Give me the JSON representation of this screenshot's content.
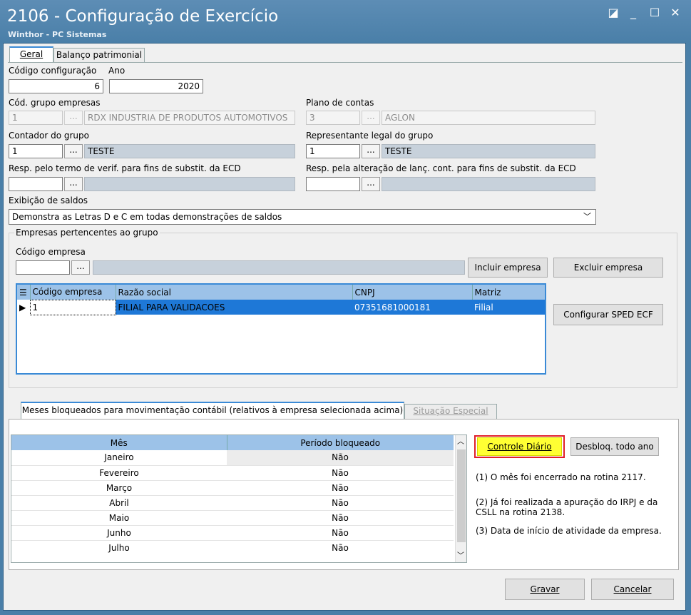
{
  "window": {
    "title": "2106 - Configuração de Exercício",
    "subtitle": "Winthor - PC Sistemas",
    "controls": [
      "◪",
      "_",
      "☐",
      "✕"
    ]
  },
  "tabs": [
    {
      "label": "Geral"
    },
    {
      "label": "Balanço patrimonial"
    }
  ],
  "fields": {
    "codigo_config_label": "Código configuração",
    "codigo_config_value": "6",
    "ano_label": "Ano",
    "ano_value": "2020",
    "grupo_empresas_label": "Cód. grupo empresas",
    "grupo_empresas_code": "1",
    "grupo_empresas_name": "RDX INDUSTRIA DE PRODUTOS AUTOMOTIVOS",
    "plano_contas_label": "Plano de contas",
    "plano_contas_code": "3",
    "plano_contas_name": "AGLON",
    "contador_label": "Contador do grupo",
    "contador_code": "1",
    "contador_name": "TESTE",
    "representante_label": "Representante legal do grupo",
    "representante_code": "1",
    "representante_name": "TESTE",
    "resp_termo_label": "Resp. pelo termo de verif. para fins de substit. da ECD",
    "resp_alteracao_label": "Resp. pela alteração de lanç. cont. para fins de substit. da ECD",
    "exibicao_label": "Exibição de saldos",
    "exibicao_value": "Demonstra as Letras D e C em todas demonstrações de saldos",
    "dots": "..."
  },
  "empresas_group": {
    "title": "Empresas pertencentes ao grupo",
    "codigo_label": "Código empresa",
    "incluir_button": "Incluir empresa",
    "excluir_button": "Excluir empresa",
    "sped_button": "Configurar SPED ECF",
    "columns": [
      "Código empresa",
      "Razão social",
      "CNPJ",
      "Matriz"
    ],
    "rows": [
      {
        "codigo": "1",
        "razao": "FILIAL PARA VALIDACOES",
        "cnpj": "07351681000181",
        "matriz": "Filial"
      }
    ]
  },
  "bottom_tabs": [
    {
      "label": "Meses bloqueados para movimentação contábil (relativos à empresa selecionada acima)"
    },
    {
      "label": "Situação Especial"
    }
  ],
  "meses": {
    "columns": [
      "Mês",
      "Período bloqueado"
    ],
    "rows": [
      {
        "mes": "Janeiro",
        "bloqueado": "Não"
      },
      {
        "mes": "Fevereiro",
        "bloqueado": "Não"
      },
      {
        "mes": "Março",
        "bloqueado": "Não"
      },
      {
        "mes": "Abril",
        "bloqueado": "Não"
      },
      {
        "mes": "Maio",
        "bloqueado": "Não"
      },
      {
        "mes": "Junho",
        "bloqueado": "Não"
      },
      {
        "mes": "Julho",
        "bloqueado": "Não"
      }
    ],
    "controle_button": "Controle Diário",
    "desbloq_button": "Desbloq. todo ano",
    "notes": [
      "(1)  O mês foi encerrado na rotina 2117.",
      "(2)  Já foi realizada a apuração do IRPJ e da CSLL na rotina 2138.",
      "(3)  Data de início de atividade da empresa."
    ]
  },
  "footer": {
    "gravar": "Gravar",
    "cancelar": "Cancelar"
  },
  "colors": {
    "titlebar": "#4a7fa8",
    "selection": "#1e78d7",
    "highlight": "#ffff33",
    "highlight_border": "#e0202a",
    "grid_header": "#9cc2e8"
  }
}
